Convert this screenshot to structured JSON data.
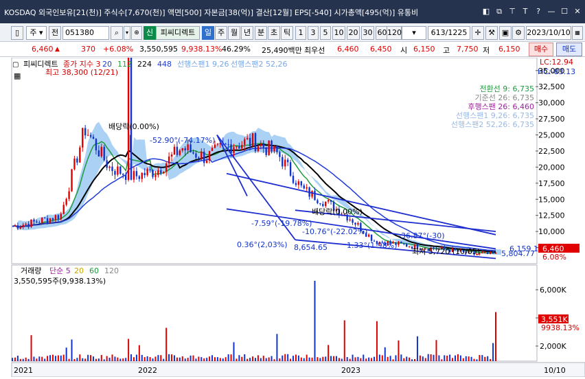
{
  "window": {
    "title": "KOSDAQ 외국인보유[21(천)] 주식수[7,670(천)] 액면[500] 자본금[38(억)] 결산[12월] EPS[-540] 시가총액[495(억)] 유통비",
    "buttons": [
      "◧",
      "⧉",
      "⊤",
      "T",
      "?",
      "—",
      "☐",
      "✕"
    ]
  },
  "toolbar": {
    "mode": "주",
    "prefix": "전",
    "code": "051380",
    "badge": "신",
    "name": "피씨디렉트",
    "periods": [
      "일",
      "주",
      "월",
      "년",
      "분",
      "초",
      "틱"
    ],
    "active_period": "일",
    "intervals": [
      "1",
      "3",
      "5",
      "10",
      "20",
      "30",
      "60",
      "120"
    ],
    "count": "613/1225",
    "date": "2023/10/10"
  },
  "quote": {
    "price": "6,460",
    "change_arrow": "▲",
    "change": "370",
    "change_pct": "+6.08%",
    "volume": "3,550,595",
    "vol_ratio": "9,938.13%",
    "turnover": "46.29%",
    "amount": "25,490백만",
    "best_label": "최우선",
    "ask": "6,460",
    "bid": "6,450",
    "open_label": "시",
    "open": "6,150",
    "high_label": "고",
    "high": "7,750",
    "low_label": "저",
    "low": "6,150",
    "buy": "매수",
    "sell": "매도"
  },
  "chart": {
    "title": "피씨디렉트",
    "legend": [
      "종가 지수 3",
      "20",
      "112",
      "224",
      "448",
      "선행스팬1 9,26",
      "선행스팬2 52,26"
    ],
    "legend_colors": [
      "#cc0000",
      "#1f3ad8",
      "#1e9a3c",
      "#000000",
      "#1f3ad8",
      "#7aa6e6",
      "#7aa6e6"
    ],
    "right_legend": [
      "전환선 9: 6,735",
      "기준선 26: 6,735",
      "후행스팬 26: 6,460",
      "선행스팬1 9,26: 6,735",
      "선행스팬2 52,26: 6,735"
    ],
    "right_legend_colors": [
      "#1e9a3c",
      "#888888",
      "#a020a0",
      "#9ab8e6",
      "#9ab8e6"
    ],
    "lc": "LC:12.94",
    "hc": "HC:-83.13",
    "high_note": "최고 38,300 (12/21)",
    "low_note": "최저 5,720 (10/05)",
    "annotations": {
      "dividend1": "배당락(0.00%)",
      "dividend2": "배당락(0.00%)",
      "a1": "-52.90°(-74.17%)",
      "a2": "-7.59°(-19.78%)",
      "a3": "-10.76°(-22.02%)",
      "a4": "0.36°(2,03%)",
      "a5": "-36.87°(-30)",
      "a6": "1.33°(1.98%)",
      "v1": "8,654.65",
      "v2": "5,804.77",
      "v3": "6,159.1"
    },
    "price_axis": [
      "35,000",
      "32,500",
      "30,000",
      "27,500",
      "25,000",
      "22,500",
      "20,000",
      "17,500",
      "15,000",
      "12,500",
      "10,000",
      "7,500"
    ],
    "last_price": "6,460",
    "last_pct": "6.08%",
    "volume_title": "거래량",
    "volume_legend": [
      "단순 5",
      "20",
      "60",
      "120"
    ],
    "volume_legend_colors": [
      "#a020a0",
      "#c8a800",
      "#1e9a3c",
      "#888888"
    ],
    "volume_value": "3,550,595주(9,938.13%)",
    "vol_axis": [
      "6,000K",
      "4,000K",
      "2,000K"
    ],
    "vol_badge": "3,551K",
    "vol_badge_pct": "9938.13%",
    "dates": [
      "2021",
      "2022",
      "2023"
    ],
    "right_date": "10/10"
  },
  "chart_data": {
    "type": "line",
    "x": [
      "2021-10",
      "2021-11",
      "2021-12",
      "2022-01",
      "2022-02",
      "2022-03",
      "2022-04",
      "2022-05",
      "2022-06",
      "2022-07",
      "2022-08",
      "2022-09",
      "2022-10",
      "2022-11",
      "2022-12",
      "2023-01",
      "2023-03",
      "2023-05",
      "2023-07",
      "2023-09",
      "2023-10"
    ],
    "series": [
      {
        "values": [
          10800,
          11500,
          12500,
          26000,
          20000,
          18500,
          19500,
          23000,
          21500,
          23500,
          24000,
          22000,
          16500,
          14500,
          12000,
          8500,
          8000,
          7500,
          7200,
          6500,
          6460
        ]
      }
    ],
    "ylim": [
      5000,
      37000
    ]
  }
}
